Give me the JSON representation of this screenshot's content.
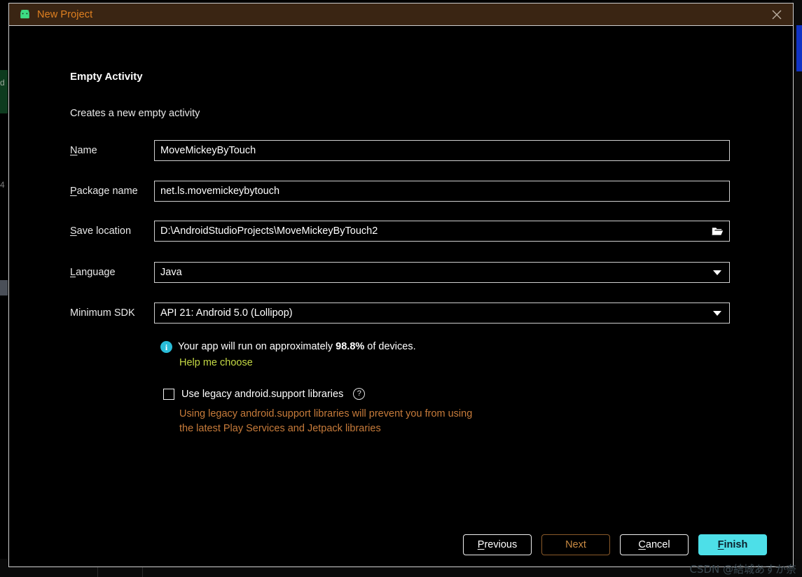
{
  "window": {
    "title": "New Project",
    "app_icon": "android-robot-icon",
    "close_icon": "close-icon",
    "titlebar_color": "#3a2513",
    "title_color": "#e08020"
  },
  "wizard": {
    "heading": "Empty Activity",
    "subheading": "Creates a new empty activity"
  },
  "fields": [
    {
      "label_prefix": "",
      "label_mnemonic": "N",
      "label_suffix": "ame",
      "name": "name",
      "value": "MoveMickeyByTouch",
      "placeholder": "",
      "control": "text"
    },
    {
      "label_prefix": "",
      "label_mnemonic": "P",
      "label_suffix": "ackage name",
      "name": "package-name",
      "value": "net.ls.movemickeybytouch",
      "placeholder": "",
      "control": "text"
    },
    {
      "label_prefix": "",
      "label_mnemonic": "S",
      "label_suffix": "ave location",
      "name": "save-location",
      "value": "D:\\AndroidStudioProjects\\MoveMickeyByTouch2",
      "placeholder": "",
      "control": "text-with-browse",
      "button_icon": "folder-open-icon"
    },
    {
      "label_prefix": "",
      "label_mnemonic": "L",
      "label_suffix": "anguage",
      "name": "language",
      "value": "Java",
      "placeholder": "",
      "control": "combo",
      "button_icon": "chevron-down-icon"
    },
    {
      "label_prefix": "Minimum SDK",
      "label_mnemonic": "",
      "label_suffix": "",
      "name": "minimum-sdk",
      "value": "API 21: Android 5.0 (Lollipop)",
      "placeholder": "",
      "control": "combo",
      "button_icon": "chevron-down-icon"
    }
  ],
  "info": {
    "icon": "info-icon",
    "text_before": "Your app will run on approximately ",
    "percentage": "98.8%",
    "text_after": " of devices.",
    "link_label": "Help me choose",
    "link_color": "#c4d944",
    "icon_color": "#29bcd8"
  },
  "legacy": {
    "checkbox_label": "Use legacy android.support libraries",
    "checked": false,
    "help_icon": "question-mark-icon",
    "warning_line1": "Using legacy android.support libraries will prevent you from using",
    "warning_line2": "the latest Play Services and Jetpack libraries",
    "warning_color": "#c77b3a"
  },
  "footer": {
    "buttons": [
      {
        "name": "previous-button",
        "mnemonic": "P",
        "rest": "revious",
        "style": "default"
      },
      {
        "name": "next-button",
        "mnemonic": "",
        "rest": "Next",
        "style": "disabled"
      },
      {
        "name": "cancel-button",
        "mnemonic": "C",
        "rest": "ancel",
        "style": "default"
      },
      {
        "name": "finish-button",
        "mnemonic": "F",
        "rest": "inish",
        "style": "primary"
      }
    ],
    "primary_color": "#4ddfe8"
  },
  "watermark": {
    "text": "CSDN @結城あすか奈"
  },
  "background": {
    "editor_char": "d",
    "line_number": "4"
  }
}
